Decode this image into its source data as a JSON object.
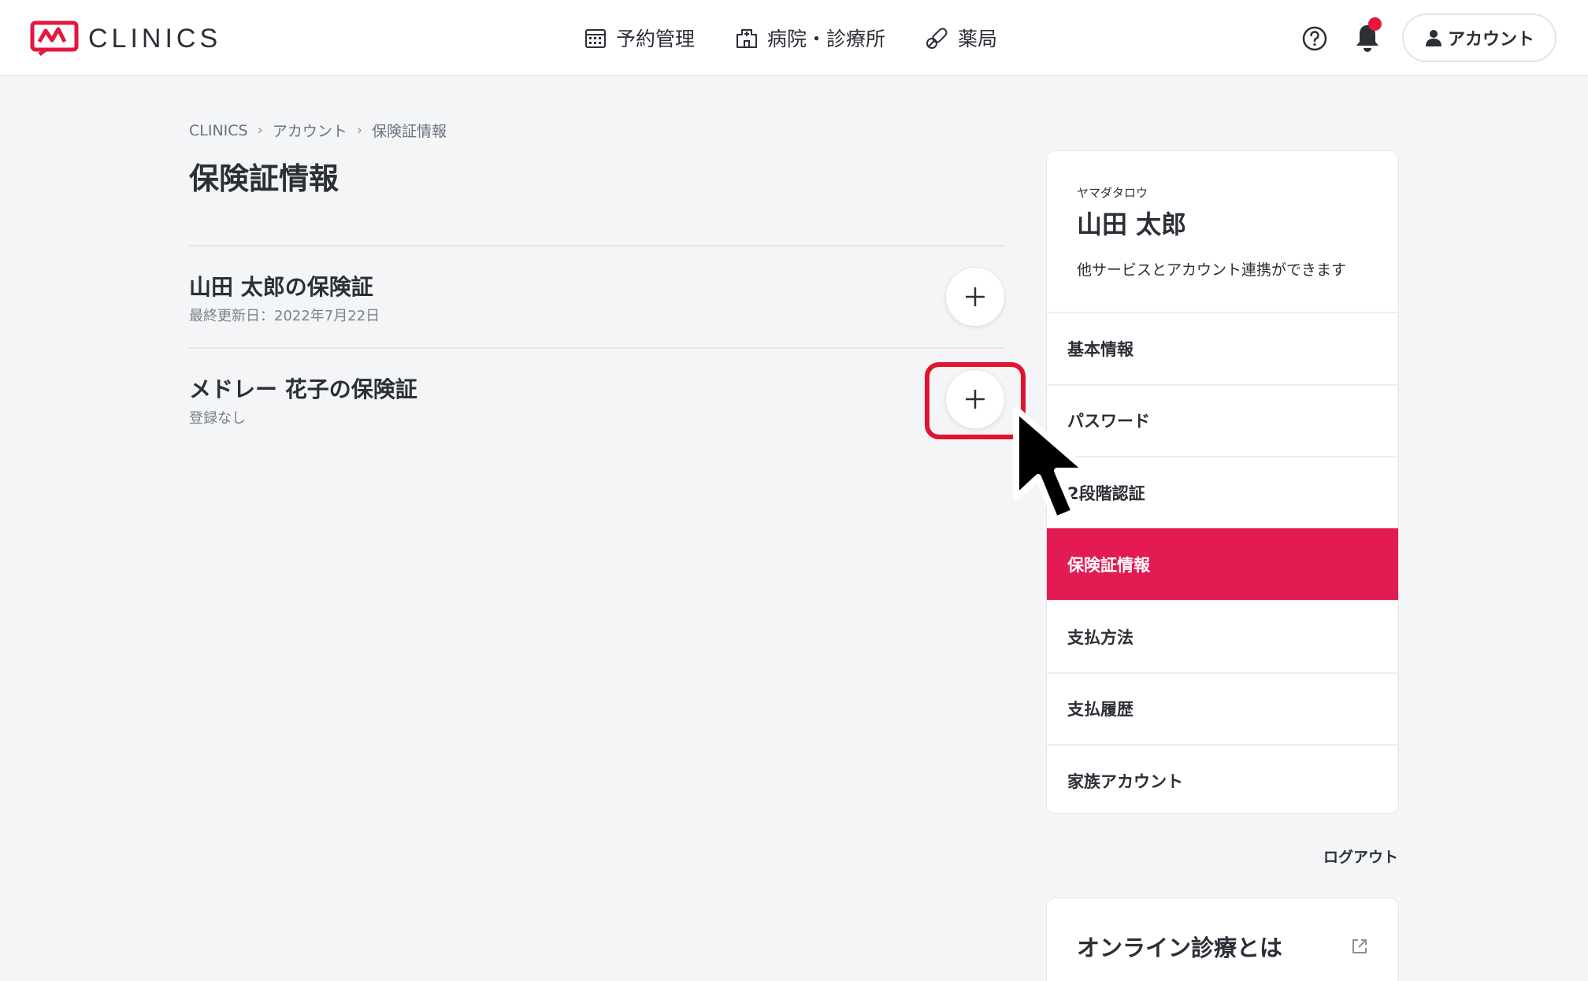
{
  "header": {
    "logo_text": "CLINICS",
    "nav": [
      {
        "label": "予約管理",
        "icon": "calendar-icon"
      },
      {
        "label": "病院・診療所",
        "icon": "hospital-icon"
      },
      {
        "label": "薬局",
        "icon": "pills-icon"
      }
    ],
    "account_label": "アカウント",
    "notification_dot_color": "#e5173f"
  },
  "breadcrumb": [
    "CLINICS",
    "アカウント",
    "保険証情報"
  ],
  "page_title": "保険証情報",
  "insurance_list": [
    {
      "title": "山田 太郎の保険証",
      "subtitle": "最終更新日：2022年7月22日"
    },
    {
      "title": "メドレー 花子の保険証",
      "subtitle": "登録なし"
    }
  ],
  "profile": {
    "kana": "ヤマダタロウ",
    "name": "山田 太郎",
    "link_note": "他サービスとアカウント連携ができます"
  },
  "menu": [
    {
      "label": "基本情報"
    },
    {
      "label": "パスワード"
    },
    {
      "label": "2段階認証"
    },
    {
      "label": "保険証情報",
      "active": true
    },
    {
      "label": "支払方法"
    },
    {
      "label": "支払履歴"
    },
    {
      "label": "家族アカウント"
    }
  ],
  "logout_label": "ログアウト",
  "online_card": {
    "title": "オンライン診療とは"
  },
  "colors": {
    "accent": "#e31b53",
    "highlight": "#e0142f"
  }
}
